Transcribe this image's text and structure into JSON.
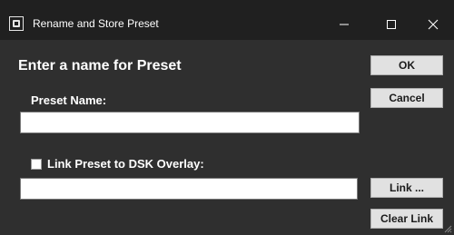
{
  "window": {
    "title": "Rename and Store Preset",
    "icon": "app-icon",
    "controls": {
      "minimize": "minimize-icon",
      "maximize": "maximize-icon",
      "close": "close-icon"
    }
  },
  "dialog": {
    "heading": "Enter a name for Preset",
    "preset_name_label": "Preset Name:",
    "preset_name_value": "",
    "link_checkbox_label": "Link Preset to DSK Overlay:",
    "link_checkbox_checked": false,
    "dsk_overlay_value": ""
  },
  "buttons": {
    "ok": "OK",
    "cancel": "Cancel",
    "link": "Link ...",
    "clear_link": "Clear Link"
  },
  "colors": {
    "window_bg": "#2f2f2f",
    "titlebar_bg": "#202020",
    "button_bg": "#e1e1e1",
    "text": "#ffffff"
  }
}
